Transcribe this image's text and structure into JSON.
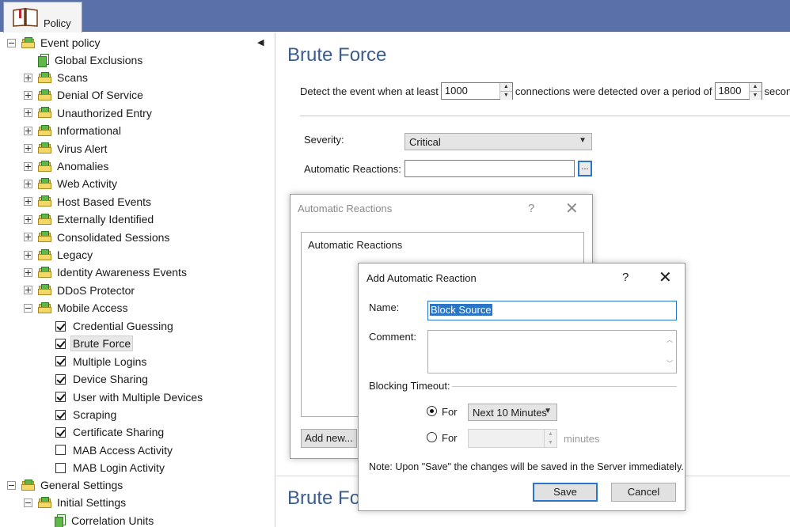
{
  "topbar": {
    "tab_label": "Policy"
  },
  "tree": {
    "event_policy": "Event policy",
    "global_exclusions": "Global Exclusions",
    "categories": [
      "Scans",
      "Denial Of Service",
      "Unauthorized Entry",
      "Informational",
      "Virus Alert",
      "Anomalies",
      "Web Activity",
      "Host Based Events",
      "Externally Identified",
      "Consolidated Sessions",
      "Legacy",
      "Identity Awareness Events",
      "DDoS Protector"
    ],
    "mobile_access": "Mobile Access",
    "mobile_items": [
      {
        "label": "Credential Guessing",
        "checked": true
      },
      {
        "label": "Brute Force",
        "checked": true
      },
      {
        "label": "Multiple Logins",
        "checked": true
      },
      {
        "label": "Device Sharing",
        "checked": true
      },
      {
        "label": "User with Multiple Devices",
        "checked": true
      },
      {
        "label": "Scraping",
        "checked": true
      },
      {
        "label": "Certificate Sharing",
        "checked": true
      },
      {
        "label": "MAB Access Activity",
        "checked": false
      },
      {
        "label": "MAB Login Activity",
        "checked": false
      }
    ],
    "general_settings": "General Settings",
    "initial_settings": "Initial Settings",
    "correlation_units": "Correlation Units"
  },
  "main": {
    "title": "Brute Force",
    "detect_prefix": "Detect the event when at least",
    "connections_value": "1000",
    "detect_middle": "connections were detected over a period of",
    "period_value": "1800",
    "detect_suffix": "seconds.",
    "severity_label": "Severity:",
    "severity_value": "Critical",
    "auto_reactions_label": "Automatic Reactions:",
    "auto_reactions_value": "",
    "ellipsis": "...",
    "lower_title": "Brute For"
  },
  "reactions_dialog": {
    "title": "Automatic Reactions",
    "help": "?",
    "list_header": "Automatic Reactions",
    "add_new": "Add new..."
  },
  "add_dialog": {
    "title": "Add Automatic Reaction",
    "help": "?",
    "name_label": "Name:",
    "name_value": "Block Source",
    "comment_label": "Comment:",
    "comment_value": "",
    "blocking_label": "Blocking Timeout:",
    "for_label_1": "For",
    "for_select_value": "Next 10 Minutes",
    "for_label_2": "For",
    "minutes_value": "",
    "minutes_label": "minutes",
    "note": "Note:  Upon \"Save\" the changes will be saved in the Server immediately.",
    "save": "Save",
    "cancel": "Cancel",
    "selected_option": "for_preset"
  }
}
